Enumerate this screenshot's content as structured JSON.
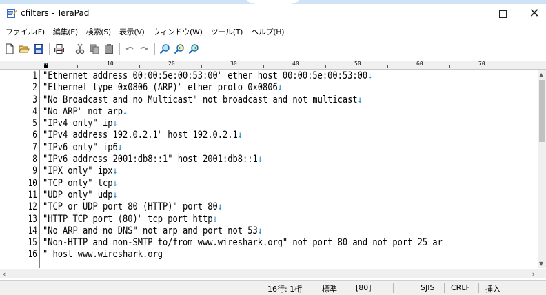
{
  "window": {
    "title": "cfilters - TeraPad"
  },
  "menu": {
    "items": [
      "ファイル(F)",
      "編集(E)",
      "検索(S)",
      "表示(V)",
      "ウィンドウ(W)",
      "ツール(T)",
      "ヘルプ(H)"
    ]
  },
  "toolbar": {
    "buttons": [
      "new-file-icon",
      "open-folder-icon",
      "save-icon",
      "print-icon",
      "cut-icon",
      "copy-icon",
      "paste-icon",
      "undo-icon",
      "redo-icon",
      "find-icon",
      "find-next-icon",
      "find-prev-icon"
    ]
  },
  "ruler": {
    "marks": [
      "0",
      "10",
      "20",
      "30",
      "40",
      "50",
      "60",
      "70"
    ]
  },
  "editor": {
    "line_numbers": [
      "1",
      "2",
      "3",
      "4",
      "5",
      "6",
      "7",
      "8",
      "9",
      "10",
      "11",
      "12",
      "13",
      "14",
      "15",
      "16"
    ],
    "lines": [
      "\"Ethernet address 00:00:5e:00:53:00\" ether host 00:00:5e:00:53:00",
      "\"Ethernet type 0x0806 (ARP)\" ether proto 0x0806",
      "\"No Broadcast and no Multicast\" not broadcast and not multicast",
      "\"No ARP\" not arp",
      "\"IPv4 only\" ip",
      "\"IPv4 address 192.0.2.1\" host 192.0.2.1",
      "\"IPv6 only\" ip6",
      "\"IPv6 address 2001:db8::1\" host 2001:db8::1",
      "\"IPX only\" ipx",
      "\"TCP only\" tcp",
      "\"UDP only\" udp",
      "\"TCP or UDP port 80 (HTTP)\" port 80",
      "\"HTTP TCP port (80)\" tcp port http",
      "\"No ARP and no DNS\" not arp and port not 53",
      "\"Non-HTTP and non-SMTP to/from www.wireshark.org\" not port 80 and not port 25 ar",
      "\" host www.wireshark.org"
    ],
    "eol_marker": "↓",
    "eol_color": "#1e88c8"
  },
  "status": {
    "position": "16行:  1桁",
    "mode": "標準",
    "width": "[80]",
    "encoding": "SJIS",
    "line_ending": "CRLF",
    "insert_mode": "挿入"
  }
}
